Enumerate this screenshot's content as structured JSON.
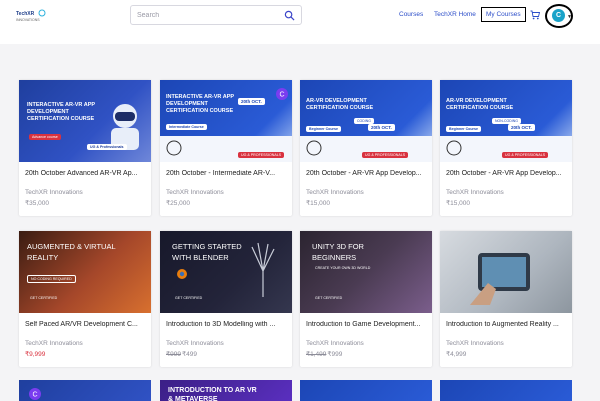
{
  "header": {
    "logo_text": "TechXR",
    "logo_sub": "INNOVATIONS",
    "search_placeholder": "Search",
    "nav_courses": "Courses",
    "nav_home": "TechXR Home",
    "nav_my_courses": "My Courses",
    "avatar_initial": "C"
  },
  "courses": [
    {
      "title": "20th October Advanced AR-VR Ap...",
      "provider": "TechXR Innovations",
      "price": "₹35,000",
      "old_price": "",
      "thumb_title": "INTERACTIVE AR-VR APP DEVELOPMENT CERTIFICATION COURSE",
      "thumb_badge": "Advance course",
      "thumb_badge2": "UG & Professionals"
    },
    {
      "title": "20th October - Intermediate AR-V...",
      "provider": "TechXR Innovations",
      "price": "₹25,000",
      "old_price": "",
      "thumb_title": "INTERACTIVE AR-VR APP DEVELOPMENT CERTIFICATION COURSE",
      "thumb_badge": "Intermediate Course",
      "thumb_badge2": "UG & PROFESSIONALS",
      "thumb_date": "20th OCT."
    },
    {
      "title": "20th October - AR-VR App Develop...",
      "provider": "TechXR Innovations",
      "price": "₹15,000",
      "old_price": "",
      "thumb_title": "AR-VR DEVELOPMENT CERTIFICATION COURSE",
      "thumb_badge": "Beginner Course",
      "thumb_badge2": "UG & PROFESSIONALS",
      "thumb_date": "20th OCT.",
      "thumb_tag": "CODING"
    },
    {
      "title": "20th October - AR-VR App Develop...",
      "provider": "TechXR Innovations",
      "price": "₹15,000",
      "old_price": "",
      "thumb_title": "AR-VR DEVELOPMENT CERTIFICATION COURSE",
      "thumb_badge": "Beginner Course",
      "thumb_badge2": "UG & PROFESSIONALS",
      "thumb_date": "20th OCT.",
      "thumb_tag": "NON-CODING"
    },
    {
      "title": "Self Paced AR/VR Development C...",
      "provider": "TechXR Innovations",
      "price": "₹9,999",
      "old_price": "",
      "thumb_title": "AUGMENTED & VIRTUAL REALITY",
      "thumb_badge": "NO CODING REQUIRED",
      "thumb_badge2": "GET CERTIFIED"
    },
    {
      "title": "Introduction to 3D Modelling with ...",
      "provider": "TechXR Innovations",
      "price": "₹499",
      "old_price": "₹999",
      "thumb_title": "GETTING STARTED WITH BLENDER",
      "thumb_badge2": "GET CERTIFIED"
    },
    {
      "title": "Introduction to Game Development...",
      "provider": "TechXR Innovations",
      "price": "₹999",
      "old_price": "₹1,499",
      "thumb_title": "UNITY 3D FOR BEGINNERS",
      "thumb_badge": "CREATE YOUR OWN 3D WORLD",
      "thumb_badge2": "GET CERTIFIED"
    },
    {
      "title": "Introduction to Augmented Reality ...",
      "provider": "TechXR Innovations",
      "price": "₹4,999",
      "old_price": "",
      "thumb_title": ""
    }
  ],
  "bottom_cards": [
    {
      "thumb_title": ""
    },
    {
      "thumb_title": "INTRODUCTION TO AR VR & METAVERSE"
    },
    {
      "thumb_title": ""
    },
    {
      "thumb_title": ""
    }
  ],
  "colors": {
    "accent": "#2c4ec9",
    "banner_blue": "#1c46b5",
    "muted": "#8d8d99"
  }
}
